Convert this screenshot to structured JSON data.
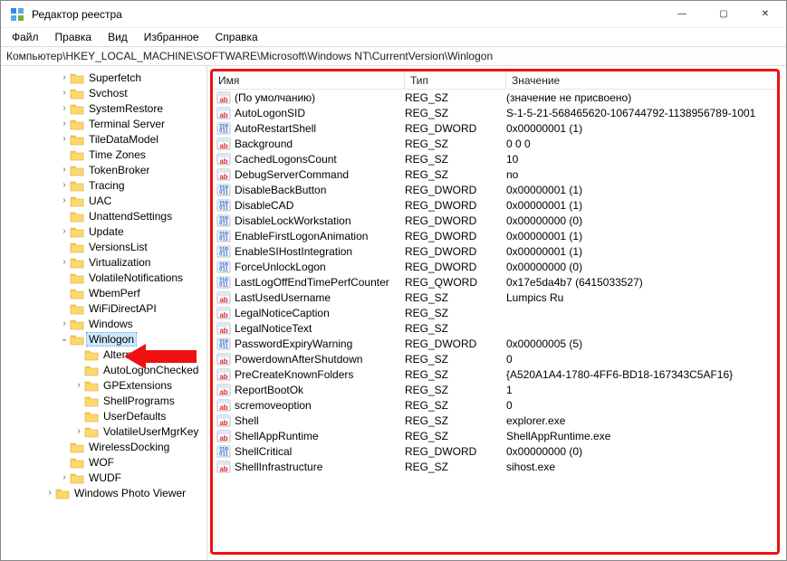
{
  "titlebar": {
    "title": "Редактор реестра"
  },
  "menu": {
    "file": "Файл",
    "edit": "Правка",
    "view": "Вид",
    "favorites": "Избранное",
    "help": "Справка"
  },
  "address": "Компьютер\\HKEY_LOCAL_MACHINE\\SOFTWARE\\Microsoft\\Windows NT\\CurrentVersion\\Winlogon",
  "tree": [
    {
      "depth": 4,
      "twisty": ">",
      "label": "Superfetch"
    },
    {
      "depth": 4,
      "twisty": ">",
      "label": "Svchost"
    },
    {
      "depth": 4,
      "twisty": ">",
      "label": "SystemRestore"
    },
    {
      "depth": 4,
      "twisty": ">",
      "label": "Terminal Server"
    },
    {
      "depth": 4,
      "twisty": ">",
      "label": "TileDataModel"
    },
    {
      "depth": 4,
      "twisty": "",
      "label": "Time Zones"
    },
    {
      "depth": 4,
      "twisty": ">",
      "label": "TokenBroker"
    },
    {
      "depth": 4,
      "twisty": ">",
      "label": "Tracing"
    },
    {
      "depth": 4,
      "twisty": ">",
      "label": "UAC"
    },
    {
      "depth": 4,
      "twisty": "",
      "label": "UnattendSettings"
    },
    {
      "depth": 4,
      "twisty": ">",
      "label": "Update"
    },
    {
      "depth": 4,
      "twisty": "",
      "label": "VersionsList"
    },
    {
      "depth": 4,
      "twisty": ">",
      "label": "Virtualization"
    },
    {
      "depth": 4,
      "twisty": "",
      "label": "VolatileNotifications"
    },
    {
      "depth": 4,
      "twisty": "",
      "label": "WbemPerf"
    },
    {
      "depth": 4,
      "twisty": "",
      "label": "WiFiDirectAPI"
    },
    {
      "depth": 4,
      "twisty": ">",
      "label": "Windows"
    },
    {
      "depth": 4,
      "twisty": "v",
      "label": "Winlogon",
      "selected": true
    },
    {
      "depth": 5,
      "twisty": "",
      "label": "AlternateShells"
    },
    {
      "depth": 5,
      "twisty": "",
      "label": "AutoLogonChecked"
    },
    {
      "depth": 5,
      "twisty": ">",
      "label": "GPExtensions"
    },
    {
      "depth": 5,
      "twisty": "",
      "label": "ShellPrograms"
    },
    {
      "depth": 5,
      "twisty": "",
      "label": "UserDefaults"
    },
    {
      "depth": 5,
      "twisty": ">",
      "label": "VolatileUserMgrKey"
    },
    {
      "depth": 4,
      "twisty": "",
      "label": "WirelessDocking"
    },
    {
      "depth": 4,
      "twisty": "",
      "label": "WOF"
    },
    {
      "depth": 4,
      "twisty": ">",
      "label": "WUDF"
    },
    {
      "depth": 3,
      "twisty": ">",
      "label": "Windows Photo Viewer"
    }
  ],
  "columns": {
    "name": "Имя",
    "type": "Тип",
    "value": "Значение"
  },
  "values": [
    {
      "icon": "sz",
      "name": "(По умолчанию)",
      "type": "REG_SZ",
      "value": "(значение не присвоено)"
    },
    {
      "icon": "sz",
      "name": "AutoLogonSID",
      "type": "REG_SZ",
      "value": "S-1-5-21-568465620-106744792-1138956789-1001"
    },
    {
      "icon": "dw",
      "name": "AutoRestartShell",
      "type": "REG_DWORD",
      "value": "0x00000001 (1)"
    },
    {
      "icon": "sz",
      "name": "Background",
      "type": "REG_SZ",
      "value": "0 0 0"
    },
    {
      "icon": "sz",
      "name": "CachedLogonsCount",
      "type": "REG_SZ",
      "value": "10"
    },
    {
      "icon": "sz",
      "name": "DebugServerCommand",
      "type": "REG_SZ",
      "value": "no"
    },
    {
      "icon": "dw",
      "name": "DisableBackButton",
      "type": "REG_DWORD",
      "value": "0x00000001 (1)"
    },
    {
      "icon": "dw",
      "name": "DisableCAD",
      "type": "REG_DWORD",
      "value": "0x00000001 (1)"
    },
    {
      "icon": "dw",
      "name": "DisableLockWorkstation",
      "type": "REG_DWORD",
      "value": "0x00000000 (0)"
    },
    {
      "icon": "dw",
      "name": "EnableFirstLogonAnimation",
      "type": "REG_DWORD",
      "value": "0x00000001 (1)"
    },
    {
      "icon": "dw",
      "name": "EnableSIHostIntegration",
      "type": "REG_DWORD",
      "value": "0x00000001 (1)"
    },
    {
      "icon": "dw",
      "name": "ForceUnlockLogon",
      "type": "REG_DWORD",
      "value": "0x00000000 (0)"
    },
    {
      "icon": "dw",
      "name": "LastLogOffEndTimePerfCounter",
      "type": "REG_QWORD",
      "value": "0x17e5da4b7 (6415033527)"
    },
    {
      "icon": "sz",
      "name": "LastUsedUsername",
      "type": "REG_SZ",
      "value": "Lumpics Ru"
    },
    {
      "icon": "sz",
      "name": "LegalNoticeCaption",
      "type": "REG_SZ",
      "value": ""
    },
    {
      "icon": "sz",
      "name": "LegalNoticeText",
      "type": "REG_SZ",
      "value": ""
    },
    {
      "icon": "dw",
      "name": "PasswordExpiryWarning",
      "type": "REG_DWORD",
      "value": "0x00000005 (5)"
    },
    {
      "icon": "sz",
      "name": "PowerdownAfterShutdown",
      "type": "REG_SZ",
      "value": "0"
    },
    {
      "icon": "sz",
      "name": "PreCreateKnownFolders",
      "type": "REG_SZ",
      "value": "{A520A1A4-1780-4FF6-BD18-167343C5AF16}"
    },
    {
      "icon": "sz",
      "name": "ReportBootOk",
      "type": "REG_SZ",
      "value": "1"
    },
    {
      "icon": "sz",
      "name": "scremoveoption",
      "type": "REG_SZ",
      "value": "0"
    },
    {
      "icon": "sz",
      "name": "Shell",
      "type": "REG_SZ",
      "value": "explorer.exe"
    },
    {
      "icon": "sz",
      "name": "ShellAppRuntime",
      "type": "REG_SZ",
      "value": "ShellAppRuntime.exe"
    },
    {
      "icon": "dw",
      "name": "ShellCritical",
      "type": "REG_DWORD",
      "value": "0x00000000 (0)"
    },
    {
      "icon": "sz",
      "name": "ShellInfrastructure",
      "type": "REG_SZ",
      "value": "sihost.exe"
    }
  ]
}
